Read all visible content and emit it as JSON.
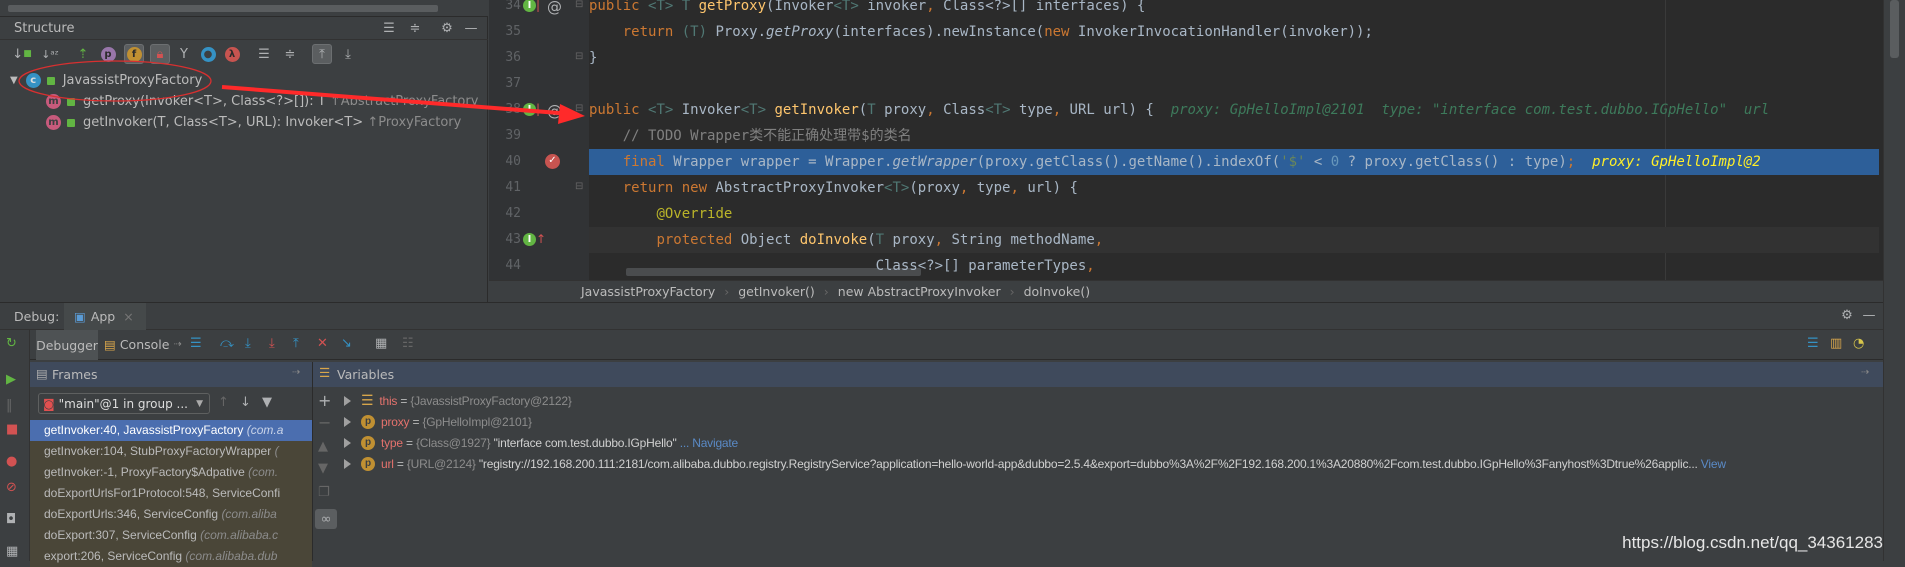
{
  "structure": {
    "title": "Structure",
    "toolbar_icons": [
      "sort-by-visibility-icon",
      "sort-alpha-icon",
      "inherited-icon",
      "properties-icon",
      "fields-icon",
      "non-public-icon",
      "anonymous-classes-icon",
      "show-classes-icon",
      "lambdas-icon",
      "expand-all-icon",
      "collapse-all-icon",
      "autoscroll-to-source-icon",
      "autoscroll-from-source-icon"
    ],
    "tree": {
      "class_name": "JavassistProxyFactory",
      "members": [
        {
          "badge": "m",
          "signature": "getProxy(Invoker<T>, Class<?>[]): T",
          "origin": "↑AbstractProxyFactory"
        },
        {
          "badge": "m",
          "signature": "getInvoker(T, Class<T>, URL): Invoker<T>",
          "origin": "↑ProxyFactory"
        }
      ]
    }
  },
  "editor": {
    "lines": [
      {
        "n": "34",
        "marks": [
          "implements",
          "at"
        ],
        "tokens": [
          [
            "kw",
            "public "
          ],
          [
            "tp",
            "<T> T "
          ],
          [
            "fn",
            "getProxy"
          ],
          [
            "",
            "(Invoker"
          ],
          [
            "tp",
            "<T>"
          ],
          [
            "",
            " invoker"
          ],
          [
            "kw",
            ", "
          ],
          [
            "",
            "Class<?>[] interfaces) {"
          ]
        ]
      },
      {
        "n": "35",
        "marks": [],
        "tokens": [
          [
            "",
            "    "
          ],
          [
            "kw",
            "return "
          ],
          [
            "tp",
            "(T) "
          ],
          [
            "",
            "Proxy."
          ],
          [
            "it",
            "getProxy"
          ],
          [
            "",
            "(interfaces).newInstance("
          ],
          [
            "kw",
            "new "
          ],
          [
            "",
            "InvokerInvocationHandler(invoker));"
          ]
        ]
      },
      {
        "n": "36",
        "marks": [],
        "tokens": [
          [
            "",
            "}"
          ]
        ]
      },
      {
        "n": "37",
        "marks": [],
        "tokens": []
      },
      {
        "n": "38",
        "marks": [
          "implements",
          "at"
        ],
        "tokens": [
          [
            "kw",
            "public "
          ],
          [
            "tp",
            "<T> "
          ],
          [
            "",
            "Invoker"
          ],
          [
            "tp",
            "<T> "
          ],
          [
            "fn",
            "getInvoker"
          ],
          [
            "",
            "("
          ],
          [
            "tp",
            "T "
          ],
          [
            "",
            "proxy"
          ],
          [
            "kw",
            ", "
          ],
          [
            "",
            "Class"
          ],
          [
            "tp",
            "<T>"
          ],
          [
            "",
            " type"
          ],
          [
            "kw",
            ", "
          ],
          [
            "",
            "URL url) {  "
          ],
          [
            "hint",
            "proxy: GpHelloImpl@2101  type: \"interface com.test.dubbo.IGpHello\"  url"
          ]
        ]
      },
      {
        "n": "39",
        "marks": [],
        "tokens": [
          [
            "",
            "    "
          ],
          [
            "cm",
            "// TODO Wrapper类不能正确处理带$的类名"
          ]
        ]
      },
      {
        "n": "40",
        "marks": [
          "breakpoint"
        ],
        "selected": true,
        "tokens": [
          [
            "",
            "    "
          ],
          [
            "kw",
            "final "
          ],
          [
            "",
            "Wrapper wrapper = Wrapper."
          ],
          [
            "it",
            "getWrapper"
          ],
          [
            "",
            "(proxy.getClass().getName().indexOf("
          ],
          [
            "str",
            "'$'"
          ],
          [
            "",
            " < "
          ],
          [
            "num",
            "0"
          ],
          [
            "",
            " ? proxy.getClass() : type)"
          ],
          [
            "kw",
            ";  "
          ],
          [
            "hint-sel",
            "proxy: GpHelloImpl@2"
          ]
        ]
      },
      {
        "n": "41",
        "marks": [],
        "tokens": [
          [
            "",
            "    "
          ],
          [
            "kw",
            "return new "
          ],
          [
            "",
            "AbstractProxyInvoker"
          ],
          [
            "tp",
            "<T>"
          ],
          [
            "",
            "(proxy"
          ],
          [
            "kw",
            ", "
          ],
          [
            "",
            "type"
          ],
          [
            "kw",
            ", "
          ],
          [
            "",
            "url) {"
          ]
        ]
      },
      {
        "n": "42",
        "marks": [],
        "tokens": [
          [
            "",
            "        "
          ],
          [
            "an",
            "@Override"
          ]
        ]
      },
      {
        "n": "43",
        "marks": [
          "implements-up"
        ],
        "current": true,
        "tokens": [
          [
            "",
            "        "
          ],
          [
            "kw",
            "protected "
          ],
          [
            "",
            "Object "
          ],
          [
            "fn",
            "doInvoke"
          ],
          [
            "",
            "("
          ],
          [
            "tp",
            "T "
          ],
          [
            "",
            "proxy"
          ],
          [
            "kw",
            ", "
          ],
          [
            "",
            "String methodName"
          ],
          [
            "kw",
            ","
          ]
        ]
      },
      {
        "n": "44",
        "marks": [],
        "tokens": [
          [
            "",
            "                                  Class<?>[] parameterTypes"
          ],
          [
            "kw",
            ","
          ]
        ]
      }
    ],
    "breadcrumb": [
      "JavassistProxyFactory",
      "getInvoker()",
      "new AbstractProxyInvoker",
      "doInvoke()"
    ]
  },
  "debug": {
    "label": "Debug:",
    "tab": "App",
    "subtabs": {
      "debugger": "Debugger",
      "console": "Console"
    },
    "frames_title": "Frames",
    "variables_title": "Variables",
    "thread_combo": "\"main\"@1 in group ...",
    "frames": [
      {
        "method": "getInvoker:40, JavassistProxyFactory",
        "pkg": "(com.a",
        "selected": true
      },
      {
        "method": "getInvoker:104, StubProxyFactoryWrapper",
        "pkg": "("
      },
      {
        "method": "getInvoker:-1, ProxyFactory$Adpative",
        "pkg": "(com."
      },
      {
        "method": "doExportUrlsFor1Protocol:548, ServiceConfi",
        "pkg": ""
      },
      {
        "method": "doExportUrls:346, ServiceConfig",
        "pkg": "(com.aliba"
      },
      {
        "method": "doExport:307, ServiceConfig",
        "pkg": "(com.alibaba.c"
      },
      {
        "method": "export:206, ServiceConfig",
        "pkg": "(com.alibaba.dub"
      }
    ],
    "variables": [
      {
        "badge": "field",
        "name": "this",
        "eq": " = ",
        "ref": "{JavassistProxyFactory@2122}",
        "value": "",
        "link": ""
      },
      {
        "badge": "p",
        "name": "proxy",
        "eq": " = ",
        "ref": "{GpHelloImpl@2101}",
        "value": "",
        "link": ""
      },
      {
        "badge": "p",
        "name": "type",
        "eq": " = ",
        "ref": "{Class@1927}",
        "value": " \"interface com.test.dubbo.IGpHello\"",
        "link": " ... Navigate"
      },
      {
        "badge": "p",
        "name": "url",
        "eq": " = ",
        "ref": "{URL@2124}",
        "value": " \"registry://192.168.200.111:2181/com.alibaba.dubbo.registry.RegistryService?application=hello-world-app&dubbo=2.5.4&export=dubbo%3A%2F%2F192.168.200.1%3A20880%2Fcom.test.dubbo.IGpHello%3Fanyhost%3Dtrue%26applic...",
        "link": " View"
      }
    ]
  },
  "watermark": "https://blog.csdn.net/qq_34361283",
  "colors": {
    "selection": "#2d5f99",
    "frame_selected": "#4b6eaf",
    "annotation_red": "#ff2a2a"
  }
}
